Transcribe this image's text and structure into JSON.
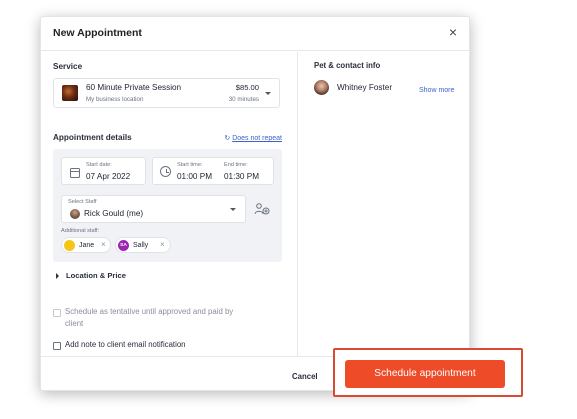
{
  "modal": {
    "title": "New Appointment",
    "close_icon": "close-icon",
    "close_glyph": "×"
  },
  "service": {
    "section_label": "Service",
    "name": "60 Minute Private Session",
    "location": "My business location",
    "price": "$85.00",
    "duration": "30 minutes"
  },
  "appointment_details": {
    "section_label": "Appointment details",
    "repeat_icon": "repeat-icon",
    "repeat_glyph": "↻",
    "repeat_link": "Does not repeat",
    "start_date_label": "Start date:",
    "start_date": "07 Apr 2022",
    "start_time_label": "Start time:",
    "start_time": "01:00 PM",
    "end_time_label": "End time:",
    "end_time": "01:30 PM",
    "staff_select_label": "Select Staff",
    "staff_selected": "Rick Gould (me)",
    "additional_staff_label": "Additional staff:",
    "additional_staff": [
      {
        "name": "Jane",
        "initials": "",
        "color": "#f5c518"
      },
      {
        "name": "Sally",
        "initials": "SA",
        "color": "#9b27b0"
      }
    ],
    "chip_remove_glyph": "×"
  },
  "location_price": {
    "label": "Location & Price"
  },
  "options": {
    "tentative_label": "Schedule as tentative until approved and paid by",
    "tentative_label_line2": "client",
    "tentative_checked": false,
    "tentative_disabled": true,
    "note_label": "Add note to client email notification",
    "note_checked": false
  },
  "pet_contact": {
    "heading": "Pet & contact info",
    "client_name": "Whitney Foster",
    "show_more": "Show more"
  },
  "footer": {
    "cancel_label": "Cancel",
    "schedule_label": "Schedule appointment"
  },
  "colors": {
    "accent": "#ee4b28",
    "highlight_border": "#d84a31",
    "link": "#3d63c7"
  }
}
